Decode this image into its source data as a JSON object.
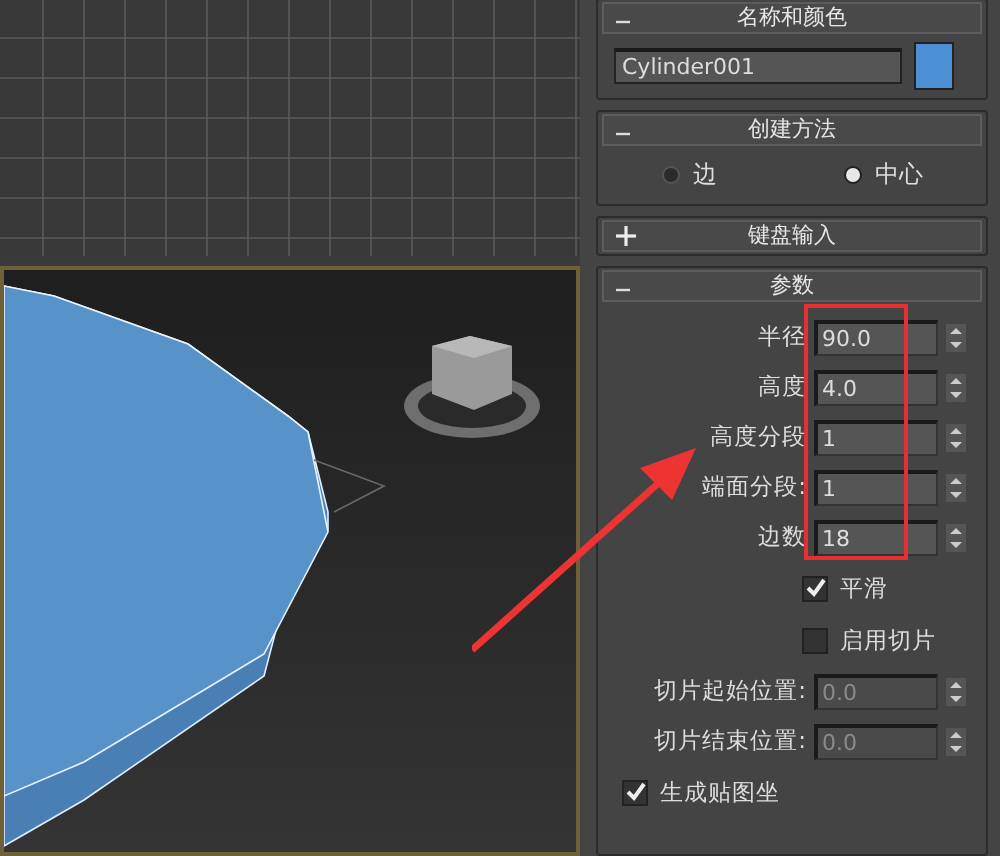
{
  "name_rollout": {
    "title": "名称和颜色",
    "expanded": true,
    "name_value": "Cylinder001",
    "color": "#4d90d6"
  },
  "creation_rollout": {
    "title": "创建方法",
    "expanded": true,
    "options": [
      {
        "label": "边",
        "selected": false
      },
      {
        "label": "中心",
        "selected": true
      }
    ]
  },
  "keyboard_rollout": {
    "title": "键盘输入",
    "expanded": false
  },
  "params_rollout": {
    "title": "参数",
    "expanded": true,
    "fields": [
      {
        "label": "半径",
        "value": "90.0",
        "disabled": false
      },
      {
        "label": "高度",
        "value": "4.0",
        "disabled": false
      },
      {
        "label": "高度分段",
        "value": "1",
        "disabled": false
      },
      {
        "label": "端面分段:",
        "value": "1",
        "disabled": false
      },
      {
        "label": "边数",
        "value": "18",
        "disabled": false
      }
    ],
    "smooth": {
      "label": "平滑",
      "checked": true
    },
    "slice_on": {
      "label": "启用切片",
      "checked": false
    },
    "slice_fields": [
      {
        "label": "切片起始位置:",
        "value": "0.0",
        "disabled": true
      },
      {
        "label": "切片结束位置:",
        "value": "0.0",
        "disabled": true
      }
    ],
    "map_coords": {
      "label": "生成贴图坐",
      "checked": true
    }
  }
}
